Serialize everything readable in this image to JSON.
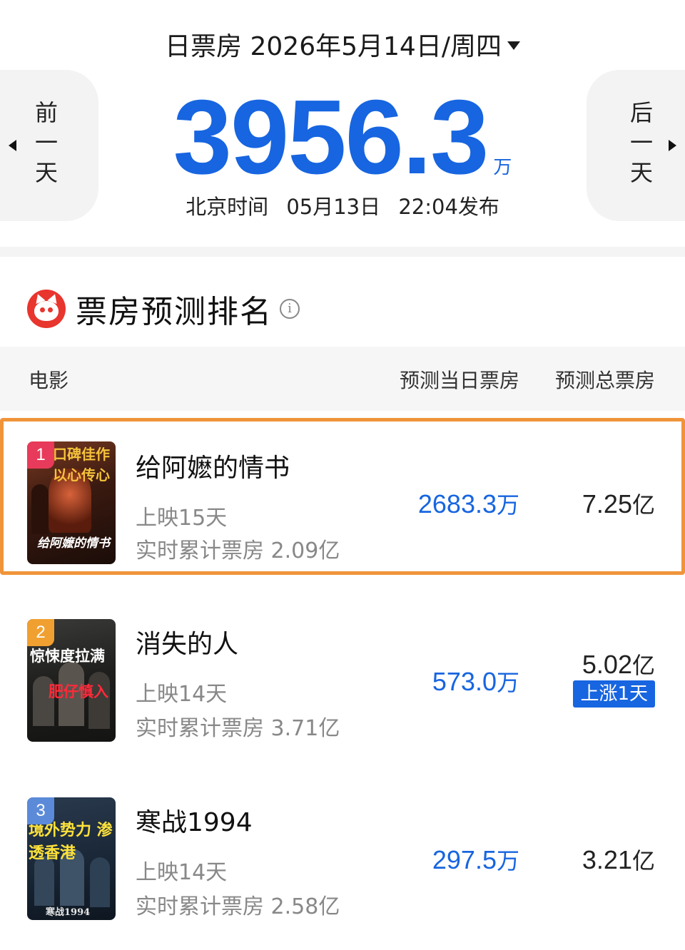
{
  "header": {
    "date_label": "日票房 2026年5月14日/周四",
    "prev_label": "前一天",
    "next_label": "后一天",
    "total_value": "3956.3",
    "total_unit": "万",
    "publish_zone": "北京时间",
    "publish_date": "05月13日",
    "publish_time": "22:04发布"
  },
  "section": {
    "title": "票房预测排名",
    "info_glyph": "i"
  },
  "table": {
    "col_movie": "电影",
    "col_day": "预测当日票房",
    "col_total": "预测总票房"
  },
  "movies": [
    {
      "rank": "1",
      "name": "给阿嬷的情书",
      "days": "上映15天",
      "cumulative": "实时累计票房 2.09亿",
      "pred_day_num": "2683.3",
      "pred_day_unit": "万",
      "pred_total_num": "7.25",
      "pred_total_unit": "亿",
      "poster_top": "口碑佳作 以心传心",
      "poster_bottom": "给阿嬷的情书"
    },
    {
      "rank": "2",
      "name": "消失的人",
      "days": "上映14天",
      "cumulative": "实时累计票房 3.71亿",
      "pred_day_num": "573.0",
      "pred_day_unit": "万",
      "pred_total_num": "5.02",
      "pred_total_unit": "亿",
      "tag": "上涨1天",
      "poster_top": "惊悚度拉满",
      "poster_bottom": "肥仔慎入"
    },
    {
      "rank": "3",
      "name": "寒战1994",
      "days": "上映14天",
      "cumulative": "实时累计票房 2.58亿",
      "pred_day_num": "297.5",
      "pred_day_unit": "万",
      "pred_total_num": "3.21",
      "pred_total_unit": "亿",
      "poster_top": "境外势力 渗透香港",
      "poster_bottom": "寒战1994"
    }
  ],
  "colors": {
    "accent_blue": "#1765e0",
    "highlight_orange": "#f0943a",
    "rank1_badge": "#e83a5a",
    "rank2_badge": "#f0a030",
    "rank3_badge": "#5b8ad8",
    "brand_red": "#e8352e"
  },
  "icons": {
    "prev": "caret-left-icon",
    "next": "caret-right-icon",
    "date_dropdown": "caret-down-icon",
    "brand": "maoyan-cat-icon",
    "info": "info-circle-icon"
  }
}
